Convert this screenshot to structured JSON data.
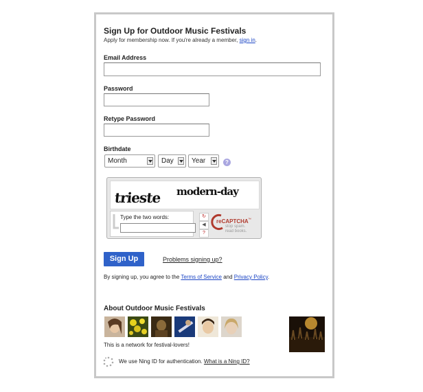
{
  "form": {
    "title": "Sign Up for Outdoor Music Festivals",
    "subtitle_text": "Apply for membership now. If you're already a member,",
    "signin_link": "sign in",
    "subtitle_end": ".",
    "email_label": "Email Address",
    "email_value": "",
    "password_label": "Password",
    "password_value": "",
    "retype_label": "Retype Password",
    "retype_value": "",
    "birthdate_label": "Birthdate",
    "month_selected": "Month",
    "day_selected": "Day",
    "year_selected": "Year",
    "help_glyph": "?"
  },
  "captcha": {
    "word1": "trieste",
    "word2": "modern-day",
    "prompt": "Type the two words:",
    "value": "",
    "brand": "reCAPTCHA",
    "tm": "™",
    "tagline1": "stop spam.",
    "tagline2": "read books.",
    "icons": [
      "refresh-icon",
      "audio-icon",
      "help-icon"
    ]
  },
  "actions": {
    "signup_label": "Sign Up",
    "problems_link": "Problems signing up?",
    "agree_text": "By signing up, you agree to the",
    "terms_link": "Terms of Service",
    "and_text": "and",
    "privacy_link": "Privacy Policy",
    "agree_end": "."
  },
  "about": {
    "title": "About Outdoor Music Festivals",
    "description": "This is a network for festival-lovers!",
    "member_photos": [
      "woman-portrait",
      "yellow-flowers",
      "person-dark-portrait",
      "guitar-player",
      "girl-smiling",
      "blonde-woman"
    ],
    "feature_photo": "concert-crowd"
  },
  "footer": {
    "ning_text": "We use Ning ID for authentication.",
    "ning_link": "What is a Ning ID?"
  },
  "colors": {
    "accent": "#2f62c9",
    "link": "#1a44c4",
    "border": "#c8c8c8",
    "help": "#a9a6e0",
    "recaptcha": "#b03a2e"
  }
}
